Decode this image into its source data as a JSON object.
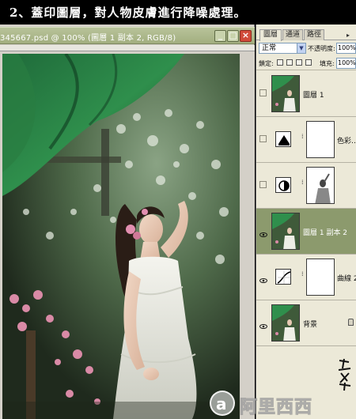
{
  "banner": {
    "instruction": "2、蓋印圖層，對人物皮膚進行降噪處理。"
  },
  "document": {
    "title": "345667.psd @ 100% (圖層 1 副本 2, RGB/8)",
    "minimize_glyph": "_",
    "maximize_glyph": "□",
    "close_glyph": "×"
  },
  "panel": {
    "tabs": [
      {
        "label": "圖層",
        "active": true
      },
      {
        "label": "通道",
        "active": false
      },
      {
        "label": "路徑",
        "active": false
      }
    ],
    "menu_glyph": "▸",
    "blend_mode": "正常",
    "blend_arrow": "▼",
    "opacity_label": "不透明度:",
    "opacity_value": "100%",
    "lock_label": "鎖定:",
    "fill_label": "填充:",
    "fill_value": "100%"
  },
  "layers": [
    {
      "name": "圖層 1",
      "visible": false,
      "selected": false,
      "kind": "pixel"
    },
    {
      "name": "色彩…",
      "visible": false,
      "selected": false,
      "kind": "adjustment",
      "icon": "color-balance-icon"
    },
    {
      "name": "",
      "visible": false,
      "selected": false,
      "kind": "adjustment",
      "icon": "hue-saturation-icon"
    },
    {
      "name": "圖層 1 副本 2",
      "visible": true,
      "selected": true,
      "kind": "pixel"
    },
    {
      "name": "曲線 2",
      "visible": true,
      "selected": false,
      "kind": "adjustment",
      "icon": "curves-icon"
    },
    {
      "name": "背景",
      "visible": true,
      "selected": false,
      "kind": "pixel",
      "locked": true
    }
  ],
  "watermark": {
    "logo_letter": "a",
    "text": "阿里西西"
  },
  "colors": {
    "titlebar": "#a2ae7f",
    "selected_layer": "#8c9a6d",
    "panel_bg": "#ece9d8"
  }
}
